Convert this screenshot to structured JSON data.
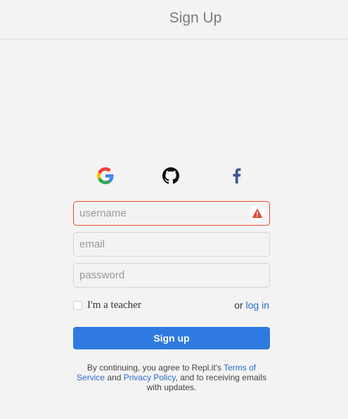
{
  "header": {
    "title": "Sign Up"
  },
  "social": {
    "google_icon": "google-icon",
    "github_icon": "github-icon",
    "facebook_icon": "facebook-icon"
  },
  "form": {
    "username": {
      "value": "",
      "placeholder": "username",
      "state": "error"
    },
    "email": {
      "value": "",
      "placeholder": "email"
    },
    "password": {
      "value": "",
      "placeholder": "password"
    },
    "teacher_label": "I'm a teacher",
    "teacher_checked": false,
    "or_text": "or",
    "login_link": "log in",
    "submit_label": "Sign up"
  },
  "legal": {
    "prefix": "By continuing, you agree to Repl.it's ",
    "terms_link": "Terms of Service",
    "and_text": " and ",
    "privacy_link": "Privacy Policy",
    "suffix": ", and to receiving emails with updates."
  },
  "colors": {
    "accent": "#2e7ae0",
    "link": "#2a69c9",
    "error": "#e34a32",
    "background": "#f4f3f3"
  }
}
